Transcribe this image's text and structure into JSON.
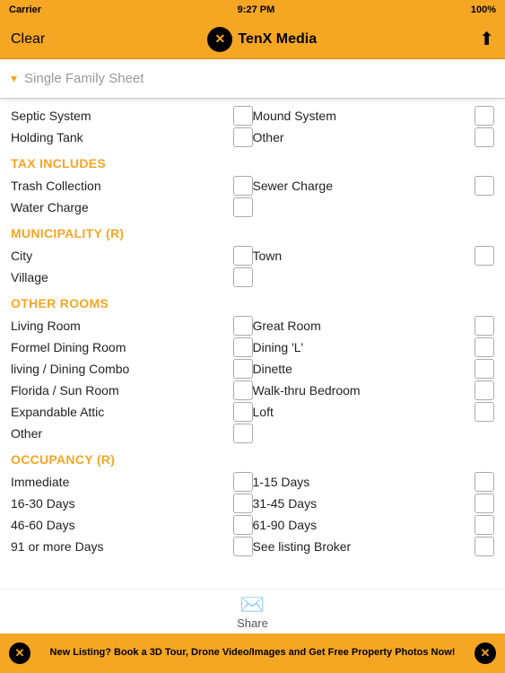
{
  "statusBar": {
    "carrier": "Carrier",
    "wifi": "WiFi",
    "time": "9:27 PM",
    "battery": "100%"
  },
  "navBar": {
    "clearLabel": "Clear",
    "title": "TenX Media",
    "shareIcon": "↑"
  },
  "dropdown": {
    "placeholder": "Single Family Sheet",
    "arrowIcon": "▾"
  },
  "sections": [
    {
      "id": "septic",
      "header": null,
      "rows": [
        {
          "left": "Septic System",
          "right": "Mound System"
        },
        {
          "left": "Holding Tank",
          "right": "Other"
        }
      ]
    },
    {
      "id": "tax",
      "header": "TAX INCLUDES",
      "rows": [
        {
          "left": "Trash Collection",
          "right": "Sewer Charge"
        },
        {
          "left": "Water Charge",
          "right": null
        }
      ]
    },
    {
      "id": "municipality",
      "header": "MUNICIPALITY (R)",
      "rows": [
        {
          "left": "City",
          "right": "Town"
        },
        {
          "left": "Village",
          "right": null
        }
      ]
    },
    {
      "id": "other-rooms",
      "header": "OTHER ROOMS",
      "rows": [
        {
          "left": "Living Room",
          "right": "Great Room"
        },
        {
          "left": "Formel Dining Room",
          "right": "Dining 'L'"
        },
        {
          "left": "living / Dining Combo",
          "right": "Dinette"
        },
        {
          "left": "Florida / Sun Room",
          "right": "Walk-thru Bedroom"
        },
        {
          "left": "Expandable Attic",
          "right": "Loft"
        },
        {
          "left": "Other",
          "right": null
        }
      ]
    },
    {
      "id": "occupancy",
      "header": "OCCUPANCY (R)",
      "rows": [
        {
          "left": "Immediate",
          "right": "1-15 Days"
        },
        {
          "left": "16-30 Days",
          "right": "31-45 Days"
        },
        {
          "left": "46-60 Days",
          "right": "61-90 Days"
        },
        {
          "left": "91 or more Days",
          "right": "See listing Broker"
        }
      ]
    }
  ],
  "share": {
    "label": "Share",
    "icon": "✉"
  },
  "banner": {
    "text": "New Listing? Book a 3D Tour, Drone Video/Images and Get Free Property Photos Now!"
  }
}
